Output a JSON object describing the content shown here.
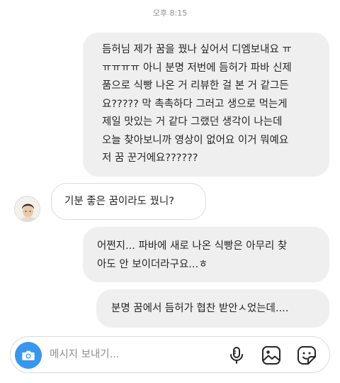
{
  "status": {
    "timestamp": "오후 8:15"
  },
  "messages": [
    {
      "direction": "sent",
      "text": "듬허님 제가 꿈을 꿨나 싶어서 디엠보내요 ㅠ\nㅠㅠㅠㅠ 아니 분명 저번에 듬허가 파바 신제\n품으로 식빵 나온 거 리뷰한 걸 본 거 같그든\n요????? 막 촉촉하다 그러고 생으로 먹는게\n제일 맛있는 거 같다 그랬던 생각이 나는데\n오늘 찾아보니까 영상이 없어요 이거 뭐예요\n저 꿈 꾼거에요??????"
    },
    {
      "direction": "received",
      "text": "기분 좋은 꿈이라도 꿨니?"
    },
    {
      "direction": "sent",
      "text": "어쩐지... 파바에 새로 나온 식빵은 아무리 찾\n아도 안 보이더라구요...ㅎ"
    },
    {
      "direction": "sent",
      "text": "분명 꿈에서 듬허가 협찬 받안ㅅ었는데...."
    }
  ],
  "composer": {
    "placeholder": "메시지 보내기...",
    "camera_icon": "camera-icon",
    "mic_icon": "microphone-icon",
    "gallery_icon": "gallery-icon",
    "sticker_icon": "sticker-icon",
    "accent_color": "#3797f0"
  },
  "colors": {
    "sent_bubble": "#efefef",
    "received_border": "#dbdbdb",
    "timestamp_text": "#8e8e8e"
  }
}
